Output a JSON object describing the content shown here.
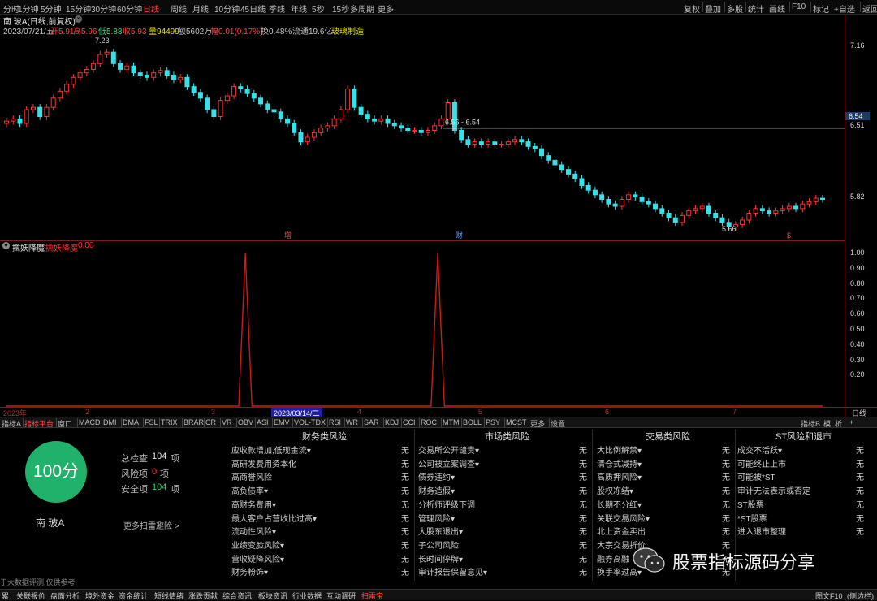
{
  "topbar": {
    "periods": [
      "分时",
      "1分钟",
      "5分钟",
      "15分钟",
      "30分钟",
      "60分钟",
      "日线",
      "周线",
      "月线",
      "10分钟",
      "45日线",
      "季线",
      "年线",
      "5秒",
      "15秒",
      "多周期",
      "更多"
    ],
    "selected_period": "日线",
    "right_buttons": [
      "复权",
      "叠加",
      "多股",
      "统计",
      "画线",
      "F10",
      "标记",
      "+自选",
      "返回"
    ]
  },
  "stock": {
    "title": "南 玻A(日线,前复权)",
    "date": "2023/07/21/五",
    "open": "开5.91",
    "high": "高5.96",
    "low": "低5.88",
    "close": "收5.93",
    "volume": "量94499",
    "amount": "额5602万",
    "change": "幅0.01(0.17%)",
    "turnover": "换0.48%",
    "float_cap": "流通19.6亿",
    "sector": "玻璃制造"
  },
  "price_chart": {
    "y_labels": [
      "7.16",
      "6.51",
      "5.82"
    ],
    "current_price": "6.54",
    "range_label": "6.56 - 6.54",
    "high_label": "7.23",
    "low_label": "5.66",
    "markers": [
      "增",
      "财",
      "$"
    ],
    "colors": {
      "up": "#ff3030",
      "down": "#38e0e8",
      "line": "#ffffff",
      "marker_purple": "#cc44cc"
    }
  },
  "indicator": {
    "name": "擒妖降魔",
    "line_name": "擒妖降魔",
    "value": "0.00",
    "y_labels": [
      "1.00",
      "0.90",
      "0.80",
      "0.70",
      "0.60",
      "0.50",
      "0.40",
      "0.30",
      "0.20"
    ],
    "spike_days": [
      36,
      65
    ],
    "color": "#d01818"
  },
  "time_axis": {
    "labels": [
      "2023年",
      "2",
      "3",
      "4",
      "5",
      "6",
      "7"
    ],
    "cursor_date": "2023/03/14/二",
    "period_label": "日线"
  },
  "indicator_tabs": [
    "指标A",
    "指标平台",
    "窗口",
    "MACD",
    "DMI",
    "DMA",
    "FSL",
    "TRIX",
    "BRAR",
    "CR",
    "VR",
    "OBV",
    "ASI",
    "EMV",
    "VOL-TDX",
    "RSI",
    "WR",
    "SAR",
    "KDJ",
    "CCI",
    "ROC",
    "MTM",
    "BOLL",
    "PSY",
    "MCST",
    "更多",
    "设置"
  ],
  "indicator_tabs_selected": "指标平台",
  "indicator_tabs_right": [
    "指标B",
    "模",
    "析",
    "+"
  ],
  "risk_panel": {
    "score": "100分",
    "stock_name": "南 玻A",
    "total_label": "总检查",
    "total_value": "104",
    "total_unit": "项",
    "risk_label": "风险项",
    "risk_value": "0",
    "risk_unit": "项",
    "safe_label": "安全项",
    "safe_value": "104",
    "safe_unit": "项",
    "more_link": "更多扫雷避险 >",
    "disclaimer": "于大数据评测,仅供参考",
    "categories": [
      {
        "title": "财务类风险",
        "items": [
          "应收款增加,低现金流▾",
          "高研发费用资本化",
          "高商誉风险",
          "高负债率▾",
          "高财务费用▾",
          "最大客户占营收比过高▾",
          "流动性风险▾",
          "业绩变脸风险▾",
          "营收疑降风险▾",
          "财务粉饰▾"
        ],
        "status": [
          "无",
          "无",
          "无",
          "无",
          "无",
          "无",
          "无",
          "无",
          "无",
          "无"
        ]
      },
      {
        "title": "市场类风险",
        "items": [
          "交易所公开谴责▾",
          "公司被立案调查▾",
          "债券违约▾",
          "财务造假▾",
          "分析师评级下调",
          "管理风险▾",
          "大股东退出▾",
          "子公司风险",
          "长时间停牌▾",
          "审计报告保留意见▾"
        ],
        "status": [
          "无",
          "无",
          "无",
          "无",
          "无",
          "无",
          "无",
          "无",
          "无",
          "无"
        ]
      },
      {
        "title": "交易类风险",
        "items": [
          "大比例解禁▾",
          "清仓式减持▾",
          "高质押风险▾",
          "股权冻结▾",
          "长期不分红▾",
          "关联交易风险▾",
          "北上资金卖出",
          "大宗交易折价",
          "融券高融",
          "换手率过高▾"
        ],
        "status": [
          "无",
          "无",
          "无",
          "无",
          "无",
          "无",
          "无",
          "无",
          "无",
          "无"
        ]
      },
      {
        "title": "ST风险和退市",
        "items": [
          "成交不活跃▾",
          "可能终止上市",
          "可能被*ST",
          "审计无法表示或否定",
          "ST股票",
          "*ST股票",
          "进入退市整理"
        ],
        "status": [
          "无",
          "无",
          "无",
          "无",
          "无",
          "无",
          "无"
        ]
      }
    ]
  },
  "footer": {
    "items": [
      "累",
      "关联报价",
      "盘面分析",
      "境外资金",
      "资金统计",
      "短线情绪",
      "涨跌贡献",
      "综合资讯",
      "板块资讯",
      "行业数据",
      "互动调研",
      "扫雷宝"
    ],
    "selected": "扫雷宝",
    "right_items": [
      "图文F10",
      "(侧边栏)"
    ]
  },
  "watermark": "股票指标源码分享"
}
